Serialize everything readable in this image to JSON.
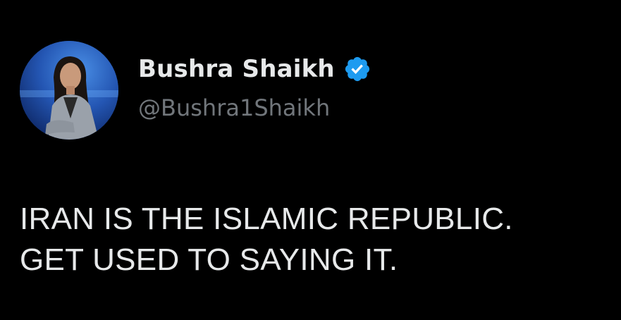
{
  "tweet": {
    "author": {
      "display_name": "Bushra Shaikh",
      "handle": "@Bushra1Shaikh",
      "verified": true,
      "verified_icon": "verified-badge-icon",
      "avatar_icon": "profile-photo"
    },
    "text_lines": [
      "IRAN IS THE ISLAMIC REPUBLIC.",
      "GET USED TO SAYING IT."
    ]
  },
  "colors": {
    "background": "#000000",
    "primary_text": "#e7e9ea",
    "secondary_text": "#71767b",
    "verified_blue": "#1d9bf0"
  }
}
